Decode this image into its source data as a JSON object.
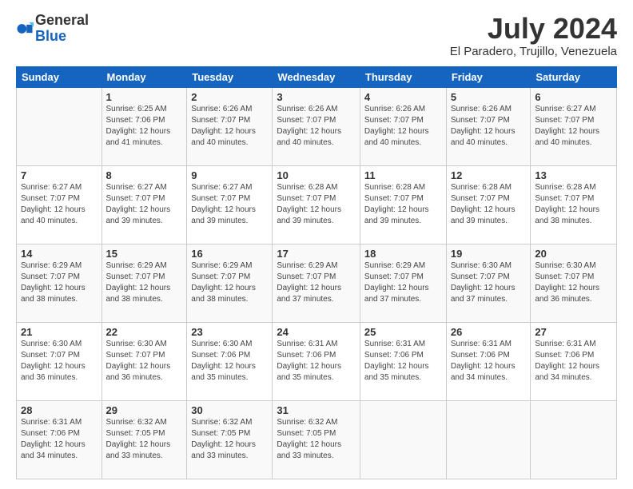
{
  "header": {
    "logo_general": "General",
    "logo_blue": "Blue",
    "month_title": "July 2024",
    "location": "El Paradero, Trujillo, Venezuela"
  },
  "weekdays": [
    "Sunday",
    "Monday",
    "Tuesday",
    "Wednesday",
    "Thursday",
    "Friday",
    "Saturday"
  ],
  "weeks": [
    [
      {
        "day": "",
        "sunrise": "",
        "sunset": "",
        "daylight": ""
      },
      {
        "day": "1",
        "sunrise": "6:25 AM",
        "sunset": "7:06 PM",
        "daylight": "12 hours and 41 minutes."
      },
      {
        "day": "2",
        "sunrise": "6:26 AM",
        "sunset": "7:07 PM",
        "daylight": "12 hours and 40 minutes."
      },
      {
        "day": "3",
        "sunrise": "6:26 AM",
        "sunset": "7:07 PM",
        "daylight": "12 hours and 40 minutes."
      },
      {
        "day": "4",
        "sunrise": "6:26 AM",
        "sunset": "7:07 PM",
        "daylight": "12 hours and 40 minutes."
      },
      {
        "day": "5",
        "sunrise": "6:26 AM",
        "sunset": "7:07 PM",
        "daylight": "12 hours and 40 minutes."
      },
      {
        "day": "6",
        "sunrise": "6:27 AM",
        "sunset": "7:07 PM",
        "daylight": "12 hours and 40 minutes."
      }
    ],
    [
      {
        "day": "7",
        "sunrise": "6:27 AM",
        "sunset": "7:07 PM",
        "daylight": "12 hours and 40 minutes."
      },
      {
        "day": "8",
        "sunrise": "6:27 AM",
        "sunset": "7:07 PM",
        "daylight": "12 hours and 39 minutes."
      },
      {
        "day": "9",
        "sunrise": "6:27 AM",
        "sunset": "7:07 PM",
        "daylight": "12 hours and 39 minutes."
      },
      {
        "day": "10",
        "sunrise": "6:28 AM",
        "sunset": "7:07 PM",
        "daylight": "12 hours and 39 minutes."
      },
      {
        "day": "11",
        "sunrise": "6:28 AM",
        "sunset": "7:07 PM",
        "daylight": "12 hours and 39 minutes."
      },
      {
        "day": "12",
        "sunrise": "6:28 AM",
        "sunset": "7:07 PM",
        "daylight": "12 hours and 39 minutes."
      },
      {
        "day": "13",
        "sunrise": "6:28 AM",
        "sunset": "7:07 PM",
        "daylight": "12 hours and 38 minutes."
      }
    ],
    [
      {
        "day": "14",
        "sunrise": "6:29 AM",
        "sunset": "7:07 PM",
        "daylight": "12 hours and 38 minutes."
      },
      {
        "day": "15",
        "sunrise": "6:29 AM",
        "sunset": "7:07 PM",
        "daylight": "12 hours and 38 minutes."
      },
      {
        "day": "16",
        "sunrise": "6:29 AM",
        "sunset": "7:07 PM",
        "daylight": "12 hours and 38 minutes."
      },
      {
        "day": "17",
        "sunrise": "6:29 AM",
        "sunset": "7:07 PM",
        "daylight": "12 hours and 37 minutes."
      },
      {
        "day": "18",
        "sunrise": "6:29 AM",
        "sunset": "7:07 PM",
        "daylight": "12 hours and 37 minutes."
      },
      {
        "day": "19",
        "sunrise": "6:30 AM",
        "sunset": "7:07 PM",
        "daylight": "12 hours and 37 minutes."
      },
      {
        "day": "20",
        "sunrise": "6:30 AM",
        "sunset": "7:07 PM",
        "daylight": "12 hours and 36 minutes."
      }
    ],
    [
      {
        "day": "21",
        "sunrise": "6:30 AM",
        "sunset": "7:07 PM",
        "daylight": "12 hours and 36 minutes."
      },
      {
        "day": "22",
        "sunrise": "6:30 AM",
        "sunset": "7:07 PM",
        "daylight": "12 hours and 36 minutes."
      },
      {
        "day": "23",
        "sunrise": "6:30 AM",
        "sunset": "7:06 PM",
        "daylight": "12 hours and 35 minutes."
      },
      {
        "day": "24",
        "sunrise": "6:31 AM",
        "sunset": "7:06 PM",
        "daylight": "12 hours and 35 minutes."
      },
      {
        "day": "25",
        "sunrise": "6:31 AM",
        "sunset": "7:06 PM",
        "daylight": "12 hours and 35 minutes."
      },
      {
        "day": "26",
        "sunrise": "6:31 AM",
        "sunset": "7:06 PM",
        "daylight": "12 hours and 34 minutes."
      },
      {
        "day": "27",
        "sunrise": "6:31 AM",
        "sunset": "7:06 PM",
        "daylight": "12 hours and 34 minutes."
      }
    ],
    [
      {
        "day": "28",
        "sunrise": "6:31 AM",
        "sunset": "7:06 PM",
        "daylight": "12 hours and 34 minutes."
      },
      {
        "day": "29",
        "sunrise": "6:32 AM",
        "sunset": "7:05 PM",
        "daylight": "12 hours and 33 minutes."
      },
      {
        "day": "30",
        "sunrise": "6:32 AM",
        "sunset": "7:05 PM",
        "daylight": "12 hours and 33 minutes."
      },
      {
        "day": "31",
        "sunrise": "6:32 AM",
        "sunset": "7:05 PM",
        "daylight": "12 hours and 33 minutes."
      },
      {
        "day": "",
        "sunrise": "",
        "sunset": "",
        "daylight": ""
      },
      {
        "day": "",
        "sunrise": "",
        "sunset": "",
        "daylight": ""
      },
      {
        "day": "",
        "sunrise": "",
        "sunset": "",
        "daylight": ""
      }
    ]
  ],
  "labels": {
    "sunrise_prefix": "Sunrise: ",
    "sunset_prefix": "Sunset: ",
    "daylight_prefix": "Daylight: "
  }
}
